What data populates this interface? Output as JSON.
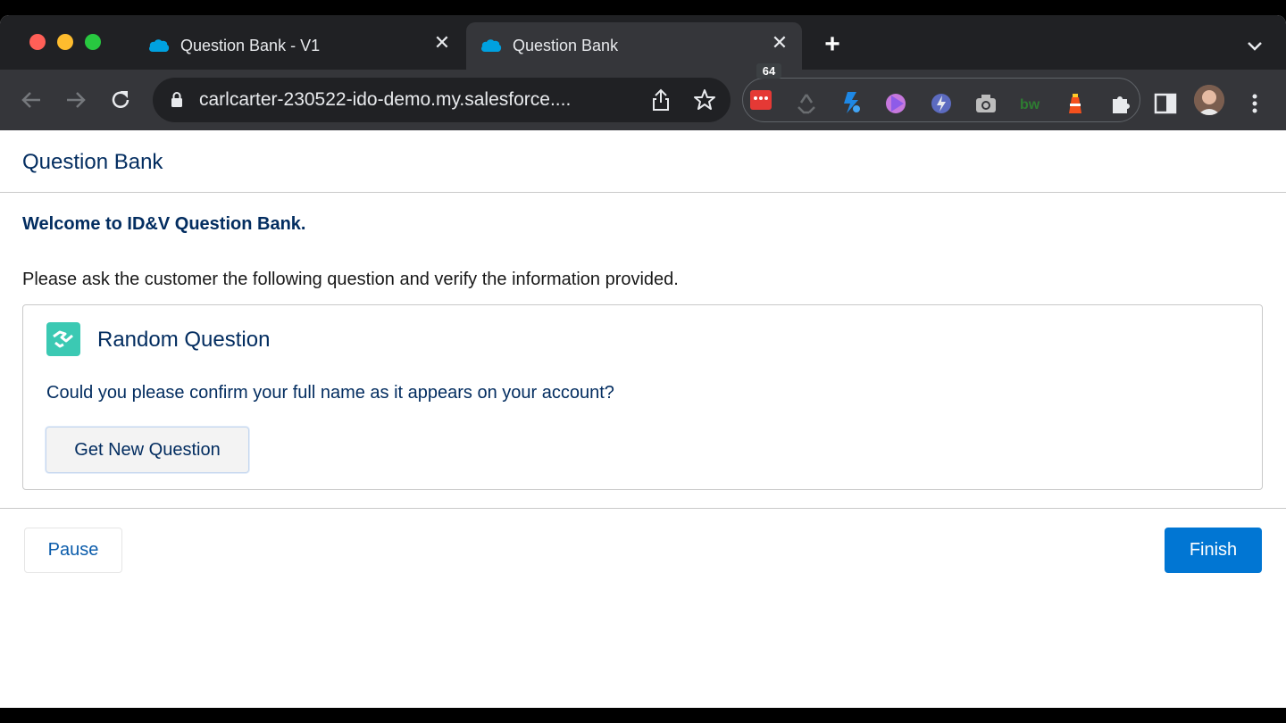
{
  "browser": {
    "tabs": [
      {
        "title": "Question Bank - V1",
        "active": false
      },
      {
        "title": "Question Bank",
        "active": true
      }
    ],
    "url": "carlcarter-230522-ido-demo.my.salesforce....",
    "extension_badge": "64",
    "icons": [
      "back-icon",
      "forward-icon",
      "reload-icon",
      "lock-icon",
      "share-icon",
      "star-icon",
      "extensions-puzzle-icon",
      "side-panel-icon",
      "profile-avatar",
      "menu-kebab-icon"
    ]
  },
  "page": {
    "title": "Question Bank",
    "welcome": "Welcome to ID&V Question Bank.",
    "instruction": "Please ask the customer the following question and verify the information provided.",
    "card": {
      "title": "Random Question",
      "question": "Could you please confirm your full name as it appears on your account?",
      "button_label": "Get New Question"
    },
    "footer": {
      "pause_label": "Pause",
      "finish_label": "Finish"
    }
  },
  "colors": {
    "brand_blue": "#0176d3",
    "heading_navy": "#032d60",
    "card_icon_teal": "#3bc9b3"
  }
}
